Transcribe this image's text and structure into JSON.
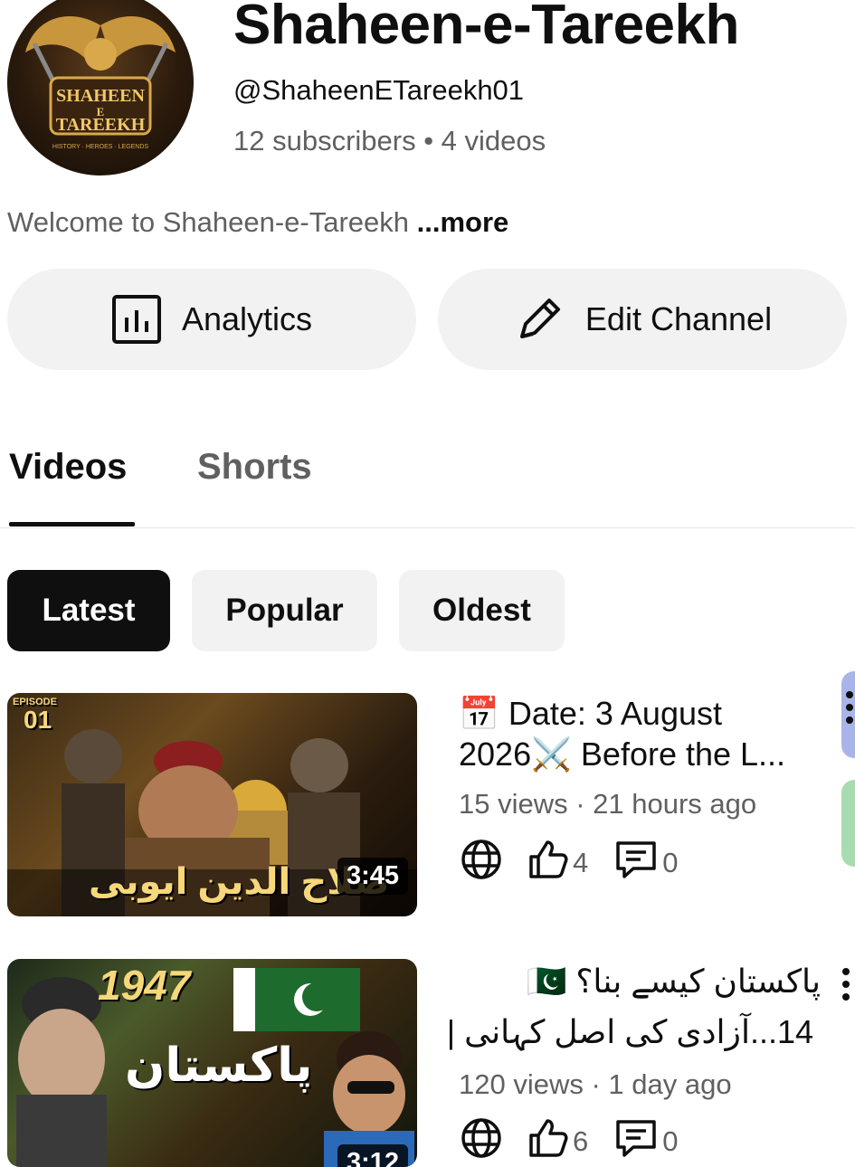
{
  "channel": {
    "name": "Shaheen-e-Tareekh",
    "handle": "@ShaheenETareekh01",
    "stats": "12 subscribers • 4 videos",
    "description": "Welcome to Shaheen-e-Tareekh ",
    "more_label": "...more",
    "logo_text_top": "SHAHEEN",
    "logo_text_mid": "E",
    "logo_text_bottom": "TAREEKH",
    "logo_tagline": "HISTORY · HEROES · LEGENDS"
  },
  "actions": {
    "analytics_label": "Analytics",
    "analytics_icon": "bar-chart-icon",
    "edit_label": "Edit Channel",
    "edit_icon": "pencil-icon"
  },
  "tabs": [
    {
      "label": "Videos",
      "active": true
    },
    {
      "label": "Shorts",
      "active": false
    }
  ],
  "chips": [
    {
      "label": "Latest",
      "selected": true
    },
    {
      "label": "Popular",
      "selected": false
    },
    {
      "label": "Oldest",
      "selected": false
    }
  ],
  "videos": [
    {
      "title_line1": "📅 Date: 3 August",
      "title_line2": "2026⚔️ Before the L...",
      "meta": "15 views · 21 hours ago",
      "likes": "4",
      "comments": "0",
      "duration": "3:45",
      "thumb_episode": "EPISODE",
      "thumb_episode_no": "01",
      "thumb_title": "صلاح الدین ایوبی"
    },
    {
      "title_line1": "پاکستان کیسے بنا؟ 🇵🇰",
      "title_line2": "14...آزادی کی اصل کہانی |",
      "meta": "120 views · 1 day ago",
      "likes": "6",
      "comments": "0",
      "duration": "3:12",
      "thumb_year": "1947",
      "thumb_title": "پاکستان"
    }
  ],
  "colors": {
    "text_primary": "#0f0f0f",
    "text_secondary": "#606060",
    "chip_bg": "#f2f2f2",
    "chip_selected_bg": "#0f0f0f",
    "side_tab_blue": "#a9b5e8",
    "side_tab_green": "#a8dcb0"
  }
}
